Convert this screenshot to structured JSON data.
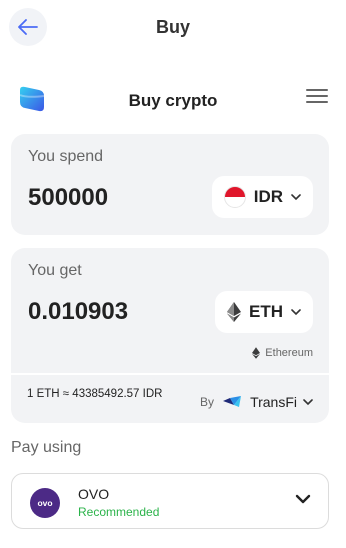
{
  "topbar": {
    "title": "Buy"
  },
  "widget": {
    "title": "Buy crypto"
  },
  "spend": {
    "label": "You spend",
    "amount": "500000",
    "currency": "IDR"
  },
  "get": {
    "label": "You get",
    "amount": "0.010903",
    "currency": "ETH",
    "network": "Ethereum"
  },
  "quote": {
    "rate": "1 ETH ≈ 43385492.57 IDR",
    "by": "By",
    "provider": "TransFi"
  },
  "pay": {
    "label": "Pay using",
    "method": "OVO",
    "logo_text": "ovo",
    "sub": "Recommended"
  },
  "colors": {
    "accent": "#4b6bf5",
    "ovo_purple": "#4c2a86",
    "recommended_green": "#2bb34a",
    "card_bg": "#f2f3f5"
  },
  "icons": {
    "back": "arrow-left-icon",
    "menu": "hamburger-menu-icon",
    "flag": "indonesia-flag-icon",
    "eth": "ethereum-icon",
    "provider": "transfi-logo-icon",
    "chevron": "chevron-down-icon"
  }
}
